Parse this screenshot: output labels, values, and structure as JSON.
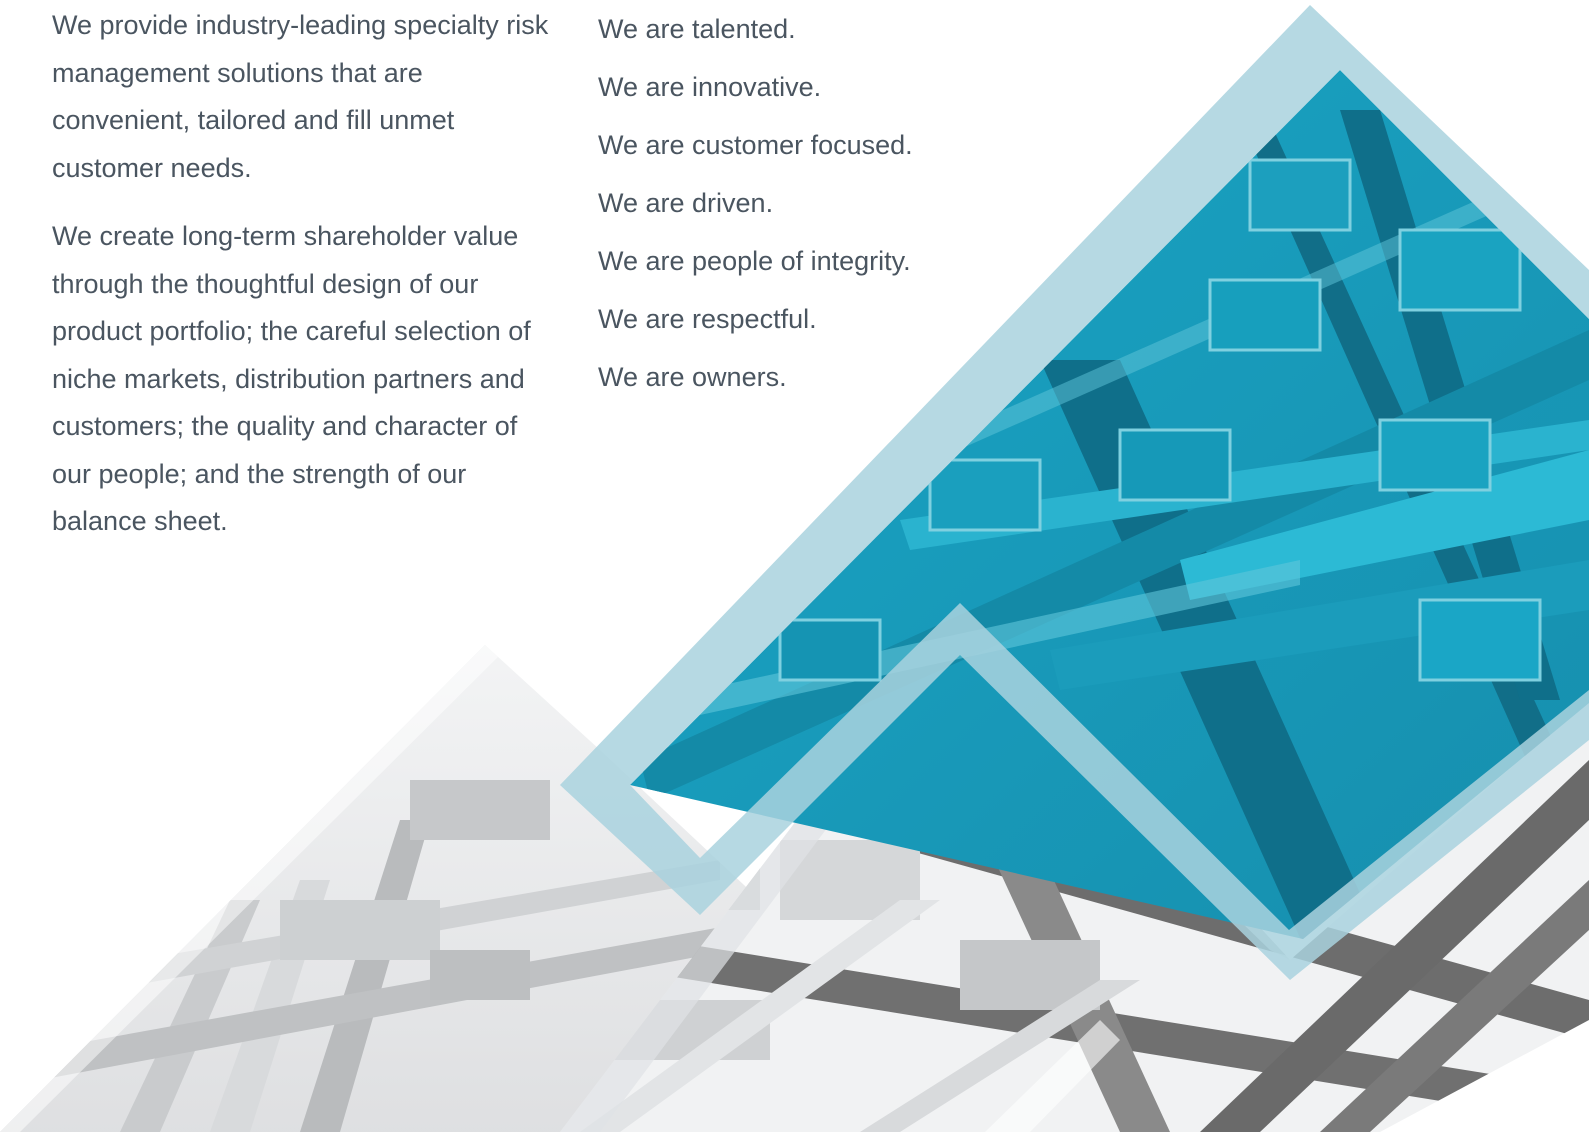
{
  "mission": {
    "paragraphs": [
      "We provide industry-leading specialty risk management solutions that are convenient, tailored and fill unmet customer needs.",
      "We create long-term shareholder value through the thoughtful design of our product portfolio; the careful selection of niche markets, distribution partners and customers; the quality and character of our people; and the strength of our balance sheet."
    ]
  },
  "values": {
    "items": [
      "We are talented.",
      "We are innovative.",
      "We are customer focused.",
      "We are driven.",
      "We are people of integrity.",
      "We are respectful.",
      "We are owners."
    ]
  },
  "artwork": {
    "description_icon": "architecture-triangles-image",
    "colors": {
      "teal": "#1a9fbe",
      "teal_dark": "#0f6f8a",
      "frame_light_blue": "#a9d2de",
      "gray_light": "#e4e6e8",
      "gray_beam": "#6d6d6d"
    }
  }
}
